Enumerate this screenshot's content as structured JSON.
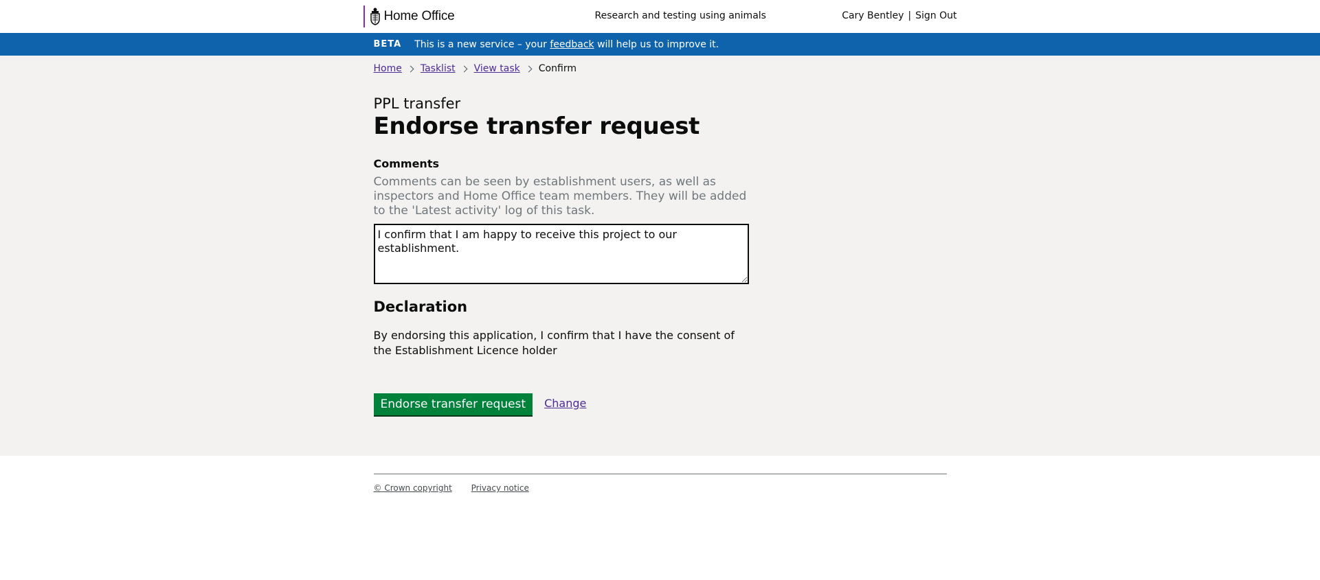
{
  "header": {
    "brand": "Home Office",
    "service_name": "Research and testing using animals",
    "user_name": "Cary Bentley",
    "separator": "|",
    "sign_out": "Sign Out"
  },
  "beta_banner": {
    "tag": "BETA",
    "text_before": "This is a new service – your",
    "link": "feedback",
    "text_after": "will help us to improve it."
  },
  "breadcrumbs": [
    {
      "label": "Home"
    },
    {
      "label": "Tasklist"
    },
    {
      "label": "View task"
    },
    {
      "label": "Confirm"
    }
  ],
  "page": {
    "caption": "PPL transfer",
    "title": "Endorse transfer request"
  },
  "comments": {
    "label": "Comments",
    "hint": "Comments can be seen by establishment users, as well as inspectors and Home Office team members. They will be added to the 'Latest activity' log of this task.",
    "value": "I confirm that I am happy to receive this project to our establishment."
  },
  "declaration": {
    "heading": "Declaration",
    "text": "By endorsing this application, I confirm that I have the consent of the Establishment Licence holder"
  },
  "actions": {
    "submit": "Endorse transfer request",
    "change": "Change"
  },
  "footer": {
    "copyright": "© Crown copyright",
    "privacy": "Privacy notice"
  },
  "colors": {
    "banner": "#0f63ad",
    "button": "#00823b",
    "link": "#4c2c92",
    "brand_stripe": "#9325b2"
  }
}
